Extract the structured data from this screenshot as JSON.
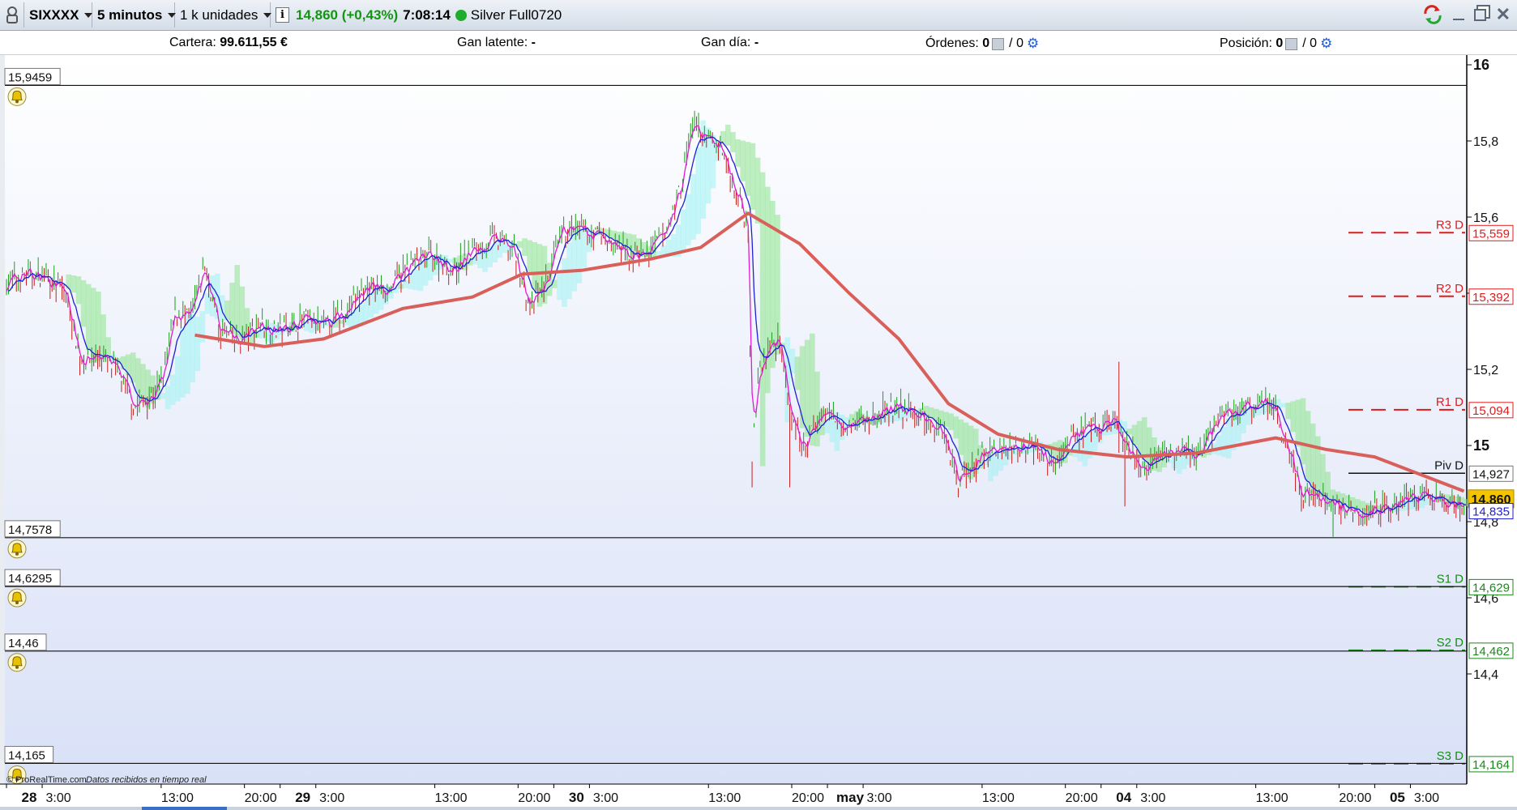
{
  "toolbar": {
    "symbol": "SIXXXX",
    "timeframe": "5 minutos",
    "units": "1 k unidades",
    "price_change": "14,860 (+0,43%)",
    "time": "7:08:14",
    "instrument": "Silver Full0720"
  },
  "status": {
    "cartera_label": "Cartera:",
    "cartera_value": "99.611,55 €",
    "gan_latente_label": "Gan latente:",
    "gan_latente_value": "-",
    "gan_dia_label": "Gan día:",
    "gan_dia_value": "-",
    "ordenes_label": "Órdenes:",
    "ordenes_value": "0",
    "ordenes_total": "/ 0",
    "posicion_label": "Posición:",
    "posicion_value": "0",
    "posicion_total": "/ 0"
  },
  "alerts": [
    {
      "price": 15.9459,
      "label": "15,9459"
    },
    {
      "price": 14.7578,
      "label": "14,7578"
    },
    {
      "price": 14.6295,
      "label": "14,6295"
    },
    {
      "price": 14.46,
      "label": "14,46"
    },
    {
      "price": 14.165,
      "label": "14,165"
    }
  ],
  "footer": {
    "brand": "© ProRealTime.com",
    "note": "Datos recibidos en tiempo real"
  },
  "colors": {
    "pivot_up": "#e01b1b",
    "pivot_down": "#1a8a1a",
    "ma": "#d9605a",
    "price_tag": "#f5c400",
    "fast": "#1f1fd6",
    "signal": "#e01bd0",
    "cloud_green": "#8de38d",
    "cloud_cyan": "#9ff3f3"
  },
  "chart_data": {
    "type": "line",
    "y_ticks": [
      "16",
      "15,8",
      "15,6",
      "15,4",
      "15,2",
      "15",
      "14,8",
      "14,6",
      "14,4"
    ],
    "ylim": [
      14.1,
      16.05
    ],
    "x_ticks": [
      {
        "label": "28",
        "bold": true,
        "i": 0
      },
      {
        "label": "3:00",
        "bold": false,
        "i": 36
      },
      {
        "label": "13:00",
        "bold": false,
        "i": 156
      },
      {
        "label": "20:00",
        "bold": false,
        "i": 240
      },
      {
        "label": "29",
        "bold": true,
        "i": 276
      },
      {
        "label": "3:00",
        "bold": false,
        "i": 312
      },
      {
        "label": "13:00",
        "bold": false,
        "i": 432
      },
      {
        "label": "20:00",
        "bold": false,
        "i": 516
      },
      {
        "label": "30",
        "bold": true,
        "i": 552
      },
      {
        "label": "3:00",
        "bold": false,
        "i": 588
      },
      {
        "label": "13:00",
        "bold": false,
        "i": 708
      },
      {
        "label": "20:00",
        "bold": false,
        "i": 792
      },
      {
        "label": "may",
        "bold": true,
        "i": 828
      },
      {
        "label": "3:00",
        "bold": false,
        "i": 864
      },
      {
        "label": "13:00",
        "bold": false,
        "i": 984
      },
      {
        "label": "20:00",
        "bold": false,
        "i": 1068
      },
      {
        "label": "04",
        "bold": true,
        "i": 1104
      },
      {
        "label": "3:00",
        "bold": false,
        "i": 1140
      },
      {
        "label": "13:00",
        "bold": false,
        "i": 1260
      },
      {
        "label": "20:00",
        "bold": false,
        "i": 1344
      },
      {
        "label": "05",
        "bold": true,
        "i": 1380
      },
      {
        "label": "3:00",
        "bold": false,
        "i": 1416
      }
    ],
    "pivots": [
      {
        "name": "R3 D",
        "value": 15.559,
        "label": "15,559",
        "kind": "up"
      },
      {
        "name": "R2 D",
        "value": 15.392,
        "label": "15,392",
        "kind": "up"
      },
      {
        "name": "R1 D",
        "value": 15.094,
        "label": "15,094",
        "kind": "up"
      },
      {
        "name": "Piv D",
        "value": 14.927,
        "label": "14,927",
        "kind": "pivot"
      },
      {
        "name": "S1 D",
        "value": 14.629,
        "label": "14,629",
        "kind": "down"
      },
      {
        "name": "S2 D",
        "value": 14.462,
        "label": "14,462",
        "kind": "down"
      },
      {
        "name": "S3 D",
        "value": 14.164,
        "label": "14,164",
        "kind": "down"
      }
    ],
    "last_price": {
      "value": 14.86,
      "label": "14,860"
    },
    "indicator_value": {
      "value": 14.835,
      "label": "14,835"
    },
    "price_anchors": [
      [
        0,
        15.43
      ],
      [
        20,
        15.45
      ],
      [
        40,
        15.44
      ],
      [
        60,
        15.4
      ],
      [
        75,
        15.22
      ],
      [
        95,
        15.24
      ],
      [
        115,
        15.18
      ],
      [
        130,
        15.1
      ],
      [
        150,
        15.14
      ],
      [
        160,
        15.2
      ],
      [
        170,
        15.35
      ],
      [
        185,
        15.33
      ],
      [
        200,
        15.47
      ],
      [
        215,
        15.3
      ],
      [
        235,
        15.27
      ],
      [
        255,
        15.32
      ],
      [
        275,
        15.3
      ],
      [
        300,
        15.33
      ],
      [
        320,
        15.31
      ],
      [
        345,
        15.36
      ],
      [
        365,
        15.42
      ],
      [
        385,
        15.41
      ],
      [
        410,
        15.48
      ],
      [
        430,
        15.5
      ],
      [
        450,
        15.46
      ],
      [
        470,
        15.51
      ],
      [
        490,
        15.54
      ],
      [
        510,
        15.52
      ],
      [
        528,
        15.36
      ],
      [
        545,
        15.43
      ],
      [
        562,
        15.57
      ],
      [
        580,
        15.56
      ],
      [
        600,
        15.55
      ],
      [
        625,
        15.5
      ],
      [
        645,
        15.5
      ],
      [
        665,
        15.56
      ],
      [
        680,
        15.68
      ],
      [
        692,
        15.85
      ],
      [
        705,
        15.8
      ],
      [
        720,
        15.79
      ],
      [
        737,
        15.66
      ],
      [
        748,
        15.58
      ],
      [
        752,
        14.95
      ],
      [
        758,
        15.18
      ],
      [
        768,
        15.25
      ],
      [
        780,
        15.29
      ],
      [
        792,
        15.05
      ],
      [
        805,
        14.99
      ],
      [
        822,
        15.09
      ],
      [
        845,
        15.06
      ],
      [
        870,
        15.07
      ],
      [
        895,
        15.1
      ],
      [
        920,
        15.08
      ],
      [
        945,
        15.04
      ],
      [
        960,
        14.91
      ],
      [
        985,
        14.98
      ],
      [
        1010,
        14.99
      ],
      [
        1030,
        15.01
      ],
      [
        1055,
        14.95
      ],
      [
        1075,
        15.03
      ],
      [
        1100,
        15.04
      ],
      [
        1115,
        15.07
      ],
      [
        1132,
        14.98
      ],
      [
        1150,
        14.93
      ],
      [
        1175,
        14.99
      ],
      [
        1200,
        14.97
      ],
      [
        1225,
        15.08
      ],
      [
        1250,
        15.1
      ],
      [
        1275,
        15.12
      ],
      [
        1290,
        15.02
      ],
      [
        1305,
        14.88
      ],
      [
        1325,
        14.86
      ],
      [
        1345,
        14.84
      ],
      [
        1370,
        14.83
      ],
      [
        1395,
        14.84
      ],
      [
        1415,
        14.87
      ],
      [
        1435,
        14.86
      ],
      [
        1455,
        14.84
      ],
      [
        1470,
        14.85
      ]
    ],
    "ma_anchors": [
      [
        190,
        15.29
      ],
      [
        260,
        15.26
      ],
      [
        320,
        15.28
      ],
      [
        400,
        15.36
      ],
      [
        470,
        15.39
      ],
      [
        520,
        15.45
      ],
      [
        580,
        15.46
      ],
      [
        650,
        15.49
      ],
      [
        700,
        15.52
      ],
      [
        748,
        15.61
      ],
      [
        800,
        15.53
      ],
      [
        850,
        15.4
      ],
      [
        900,
        15.28
      ],
      [
        950,
        15.11
      ],
      [
        1000,
        15.03
      ],
      [
        1060,
        14.99
      ],
      [
        1130,
        14.97
      ],
      [
        1200,
        14.98
      ],
      [
        1280,
        15.02
      ],
      [
        1330,
        14.99
      ],
      [
        1380,
        14.97
      ],
      [
        1430,
        14.92
      ],
      [
        1470,
        14.88
      ]
    ],
    "spike_lows": [
      [
        752,
        14.89
      ],
      [
        790,
        14.89
      ],
      [
        1128,
        14.84
      ],
      [
        1338,
        14.76
      ],
      [
        1466,
        14.8
      ]
    ],
    "spike_highs": [
      [
        695,
        15.92
      ],
      [
        1122,
        15.22
      ],
      [
        1275,
        15.2
      ],
      [
        205,
        15.5
      ]
    ]
  }
}
